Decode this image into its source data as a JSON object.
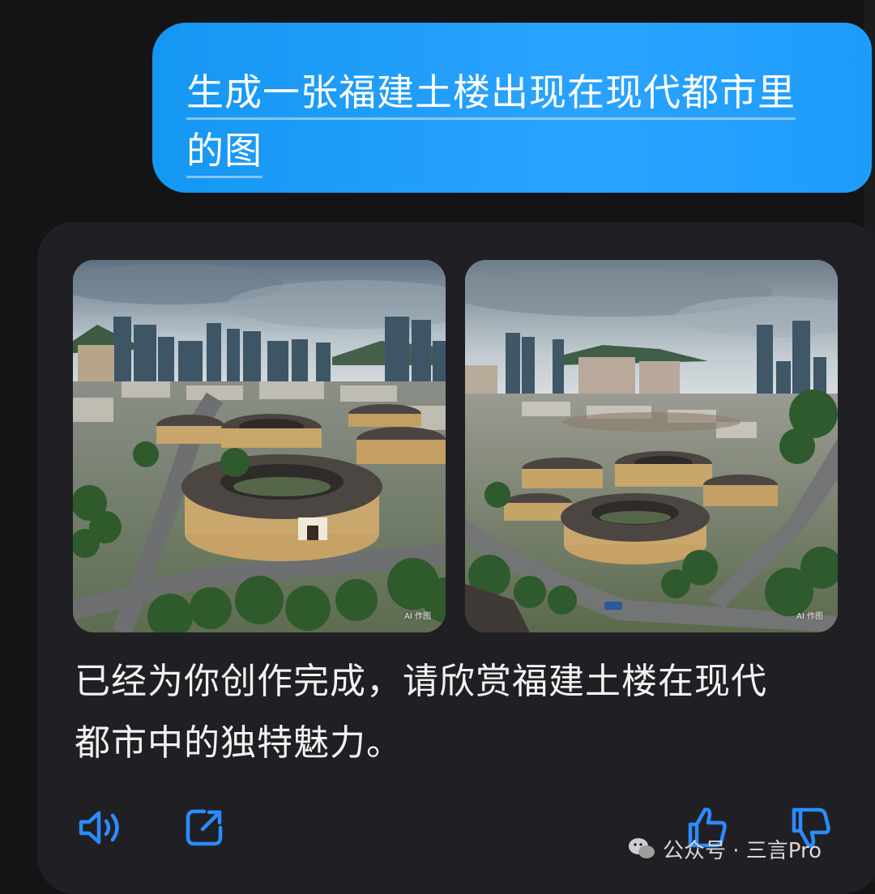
{
  "user_message": {
    "lines": [
      "生成一张福建土楼出现在现代都市里",
      "的图"
    ]
  },
  "assistant": {
    "images": [
      {
        "tag": "AI 作图",
        "subject": "fujian-tulou-city-view-1"
      },
      {
        "tag": "AI 作图",
        "subject": "fujian-tulou-city-view-2"
      }
    ],
    "reply_lines": [
      "已经为你创作完成，请欣赏福建土楼在现代",
      "都市中的独特魅力。"
    ],
    "actions": [
      "speaker-icon",
      "share-icon",
      "thumbs-up-icon",
      "thumbs-down-icon"
    ]
  },
  "watermark": {
    "text": "公众号 · 三言Pro",
    "icon": "wechat-icon"
  },
  "colors": {
    "background": "#141416",
    "card": "#202024",
    "user_bubble": "#1e9cfb",
    "accent": "#2b8cff",
    "text": "#f2f2f2"
  }
}
